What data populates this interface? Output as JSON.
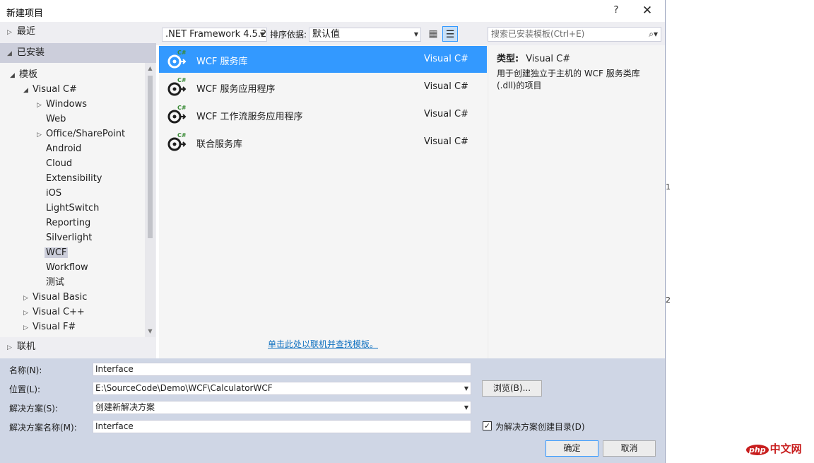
{
  "window": {
    "title": "新建项目",
    "help_label": "?",
    "close_label": "✕"
  },
  "left": {
    "recent": "最近",
    "installed": "已安装",
    "online": "联机",
    "tree": [
      {
        "label": "模板",
        "arrow": "◢",
        "indent": 0
      },
      {
        "label": "Visual C#",
        "arrow": "◢",
        "indent": 1
      },
      {
        "label": "Windows",
        "arrow": "▷",
        "indent": 2
      },
      {
        "label": "Web",
        "arrow": "",
        "indent": 2
      },
      {
        "label": "Office/SharePoint",
        "arrow": "▷",
        "indent": 2
      },
      {
        "label": "Android",
        "arrow": "",
        "indent": 2
      },
      {
        "label": "Cloud",
        "arrow": "",
        "indent": 2
      },
      {
        "label": "Extensibility",
        "arrow": "",
        "indent": 2
      },
      {
        "label": "iOS",
        "arrow": "",
        "indent": 2
      },
      {
        "label": "LightSwitch",
        "arrow": "",
        "indent": 2
      },
      {
        "label": "Reporting",
        "arrow": "",
        "indent": 2
      },
      {
        "label": "Silverlight",
        "arrow": "",
        "indent": 2
      },
      {
        "label": "WCF",
        "arrow": "",
        "indent": 2,
        "selected": true
      },
      {
        "label": "Workflow",
        "arrow": "",
        "indent": 2
      },
      {
        "label": "测试",
        "arrow": "",
        "indent": 2
      },
      {
        "label": "Visual Basic",
        "arrow": "▷",
        "indent": 1
      },
      {
        "label": "Visual C++",
        "arrow": "▷",
        "indent": 1
      },
      {
        "label": "Visual F#",
        "arrow": "▷",
        "indent": 1
      }
    ]
  },
  "toolbar": {
    "framework": ".NET Framework 4.5.2",
    "sort_label": "排序依据:",
    "sort_value": "默认值",
    "search_placeholder": "搜索已安装模板(Ctrl+E)"
  },
  "templates": [
    {
      "name": "WCF 服务库",
      "lang": "Visual C#",
      "selected": true
    },
    {
      "name": "WCF 服务应用程序",
      "lang": "Visual C#"
    },
    {
      "name": "WCF 工作流服务应用程序",
      "lang": "Visual C#"
    },
    {
      "name": "联合服务库",
      "lang": "Visual C#"
    }
  ],
  "online_link": "单击此处以联机并查找模板。",
  "description": {
    "type_label": "类型:",
    "type_value": "Visual C#",
    "text": "用于创建独立于主机的 WCF 服务类库 (.dll)的项目"
  },
  "form": {
    "name_label": "名称(N):",
    "name_value": "Interface",
    "location_label": "位置(L):",
    "location_value": "E:\\SourceCode\\Demo\\WCF\\CalculatorWCF",
    "solution_label": "解决方案(S):",
    "solution_value": "创建新解决方案",
    "solution_name_label": "解决方案名称(M):",
    "solution_name_value": "Interface",
    "browse_label": "浏览(B)...",
    "create_dir_label": "为解决方案创建目录(D)",
    "create_dir_checked": true,
    "ok_label": "确定",
    "cancel_label": "取消"
  },
  "side_numbers": [
    "1",
    "2"
  ],
  "watermark": {
    "php": "php",
    "cn": "中文网"
  },
  "colors": {
    "selection": "#3399ff",
    "link": "#0e70c0",
    "form_bg": "#cfd6e5"
  }
}
